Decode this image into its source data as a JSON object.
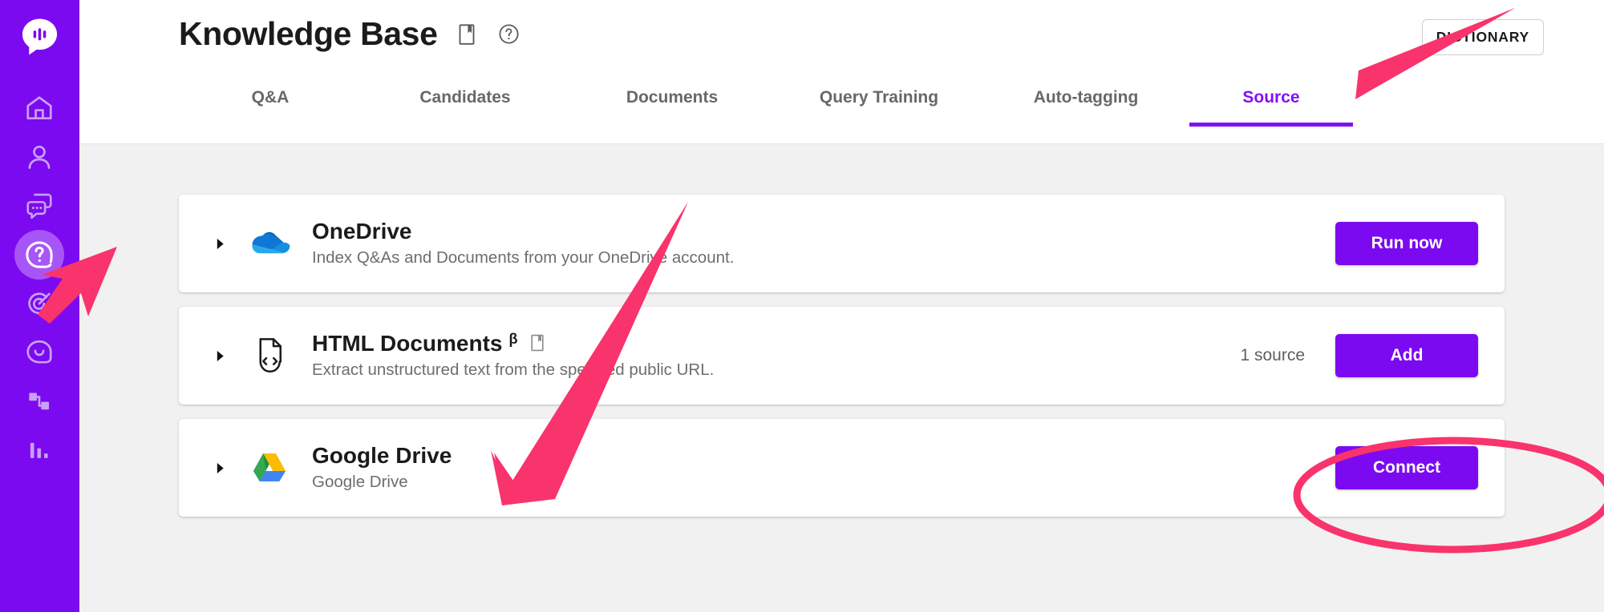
{
  "sidebar": {
    "brand_color": "#7B0AF0",
    "active_bg": "#A855F7",
    "logo_name": "app-logo",
    "items": [
      {
        "name": "home",
        "label": "Home",
        "active": false
      },
      {
        "name": "contacts",
        "label": "Contacts",
        "active": false
      },
      {
        "name": "conversations",
        "label": "Conversations",
        "active": false
      },
      {
        "name": "knowledge-base",
        "label": "Knowledge Base",
        "active": true
      },
      {
        "name": "campaigns",
        "label": "Campaigns",
        "active": false
      },
      {
        "name": "bot",
        "label": "Bot",
        "active": false
      },
      {
        "name": "scenarios",
        "label": "Scenarios",
        "active": false
      },
      {
        "name": "analytics",
        "label": "Analytics",
        "active": false
      }
    ]
  },
  "header": {
    "title": "Knowledge Base",
    "bookmark_icon": "bookmark-icon",
    "help_icon": "help-circle-icon",
    "dictionary_label": "DICTIONARY"
  },
  "tabs": {
    "active_color": "#8310F5",
    "items": [
      {
        "label": "Q&A",
        "active": false
      },
      {
        "label": "Candidates",
        "active": false
      },
      {
        "label": "Documents",
        "active": false
      },
      {
        "label": "Query Training",
        "active": false
      },
      {
        "label": "Auto-tagging",
        "active": false
      },
      {
        "label": "Source",
        "active": true
      }
    ]
  },
  "sources": [
    {
      "id": "onedrive",
      "title": "OneDrive",
      "beta": "",
      "has_bookmark": false,
      "subtitle": "Index Q&As and Documents from your OneDrive account.",
      "count_label": "",
      "action_label": "Run now",
      "icon": "onedrive-icon"
    },
    {
      "id": "html-documents",
      "title": "HTML Documents",
      "beta": "β",
      "has_bookmark": true,
      "subtitle": "Extract unstructured text from the specified public URL.",
      "count_label": "1 source",
      "action_label": "Add",
      "icon": "html-document-icon"
    },
    {
      "id": "google-drive",
      "title": "Google Drive",
      "beta": "",
      "has_bookmark": false,
      "subtitle": "Google Drive",
      "count_label": "",
      "action_label": "Connect",
      "icon": "google-drive-icon"
    }
  ],
  "annotations": {
    "color": "#F9336B",
    "arrow_to_sidebar": "arrow-pointing-knowledge-base-sidebar-icon",
    "arrow_to_source_tab": "arrow-pointing-source-tab",
    "arrow_to_google_drive": "arrow-pointing-google-drive-row",
    "ellipse_on_connect": "ellipse-highlighting-connect-button"
  },
  "colors": {
    "brand_purple": "#7B0AF0",
    "tab_active": "#8310F5",
    "page_bg": "#f1f1f1",
    "card_bg": "#ffffff",
    "annotation_pink": "#F9336B"
  }
}
